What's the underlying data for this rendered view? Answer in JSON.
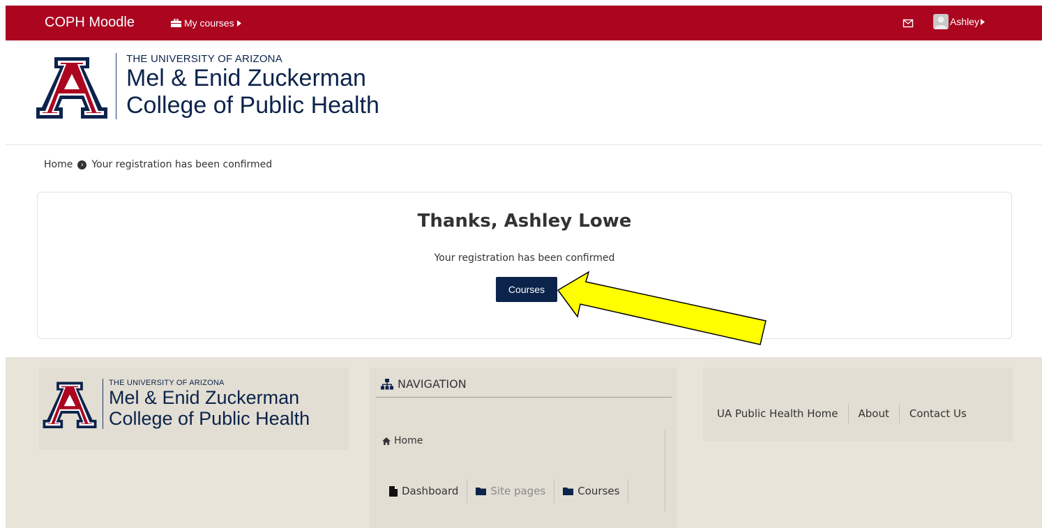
{
  "topbar": {
    "brand": "COPH Moodle",
    "my_courses": "My courses",
    "user_name": "Ashley"
  },
  "header_logo": {
    "university": "THE UNIVERSITY OF ARIZONA",
    "college_line1": "Mel & Enid Zuckerman",
    "college_line2": "College of Public Health"
  },
  "breadcrumb": {
    "home": "Home",
    "current": "Your registration has been confirmed"
  },
  "main": {
    "heading": "Thanks, Ashley Lowe",
    "message": "Your registration has been confirmed",
    "button_label": "Courses"
  },
  "footer": {
    "logo": {
      "university": "THE UNIVERSITY OF ARIZONA",
      "college_line1": "Mel & Enid Zuckerman",
      "college_line2": "College of Public Health"
    },
    "navigation": {
      "title": "NAVIGATION",
      "home": "Home",
      "items": [
        "Dashboard",
        "Site pages",
        "Courses"
      ]
    },
    "links": [
      "UA Public Health Home",
      "About",
      "Contact Us"
    ]
  },
  "colors": {
    "brand_red": "#ab0520",
    "navy": "#0c234b",
    "highlight_arrow": "#ffff00"
  }
}
